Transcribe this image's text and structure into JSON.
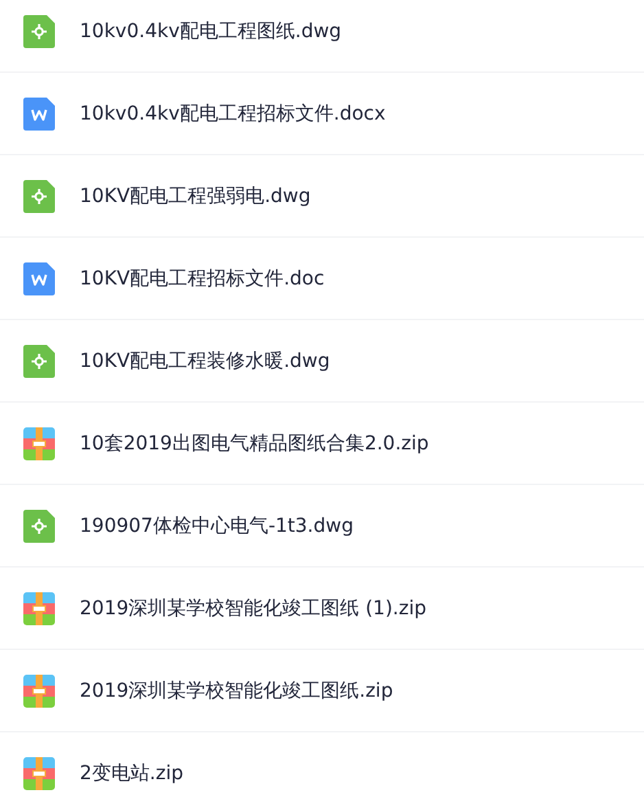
{
  "files": [
    {
      "kind": "cad",
      "name": "10kv0.4kv配电工程图纸.dwg"
    },
    {
      "kind": "word",
      "name": "10kv0.4kv配电工程招标文件.docx"
    },
    {
      "kind": "cad",
      "name": "10KV配电工程强弱电.dwg"
    },
    {
      "kind": "word",
      "name": "10KV配电工程招标文件.doc"
    },
    {
      "kind": "cad",
      "name": "10KV配电工程装修水暖.dwg"
    },
    {
      "kind": "zip",
      "name": "10套2019出图电气精品图纸合集2.0.zip"
    },
    {
      "kind": "cad",
      "name": "190907体检中心电气-1t3.dwg"
    },
    {
      "kind": "zip",
      "name": "2019深圳某学校智能化竣工图纸 (1).zip"
    },
    {
      "kind": "zip",
      "name": "2019深圳某学校智能化竣工图纸.zip"
    },
    {
      "kind": "zip",
      "name": "2变电站.zip"
    }
  ]
}
